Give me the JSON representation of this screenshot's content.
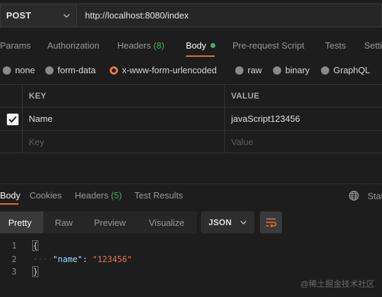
{
  "request": {
    "method": "POST",
    "url": "http://localhost:8080/index"
  },
  "request_tabs": {
    "params": "Params",
    "authorization": "Authorization",
    "headers": "Headers",
    "headers_count": "(8)",
    "body": "Body",
    "pre_request": "Pre-request Script",
    "tests": "Tests",
    "settings": "Setti"
  },
  "body_types": {
    "none": "none",
    "form_data": "form-data",
    "urlencoded": "x-www-form-urlencoded",
    "raw": "raw",
    "binary": "binary",
    "graphql": "GraphQL",
    "selected": "x-www-form-urlencoded"
  },
  "params_table": {
    "key_header": "KEY",
    "value_header": "VALUE",
    "row": {
      "key": "Name",
      "value": "javaScript123456",
      "checked": true
    },
    "placeholder_key": "Key",
    "placeholder_value": "Value"
  },
  "response_tabs": {
    "body": "Body",
    "cookies": "Cookies",
    "headers": "Headers",
    "headers_count": "(5)",
    "test_results": "Test Results",
    "status": "Stat"
  },
  "view_modes": {
    "pretty": "Pretty",
    "raw": "Raw",
    "preview": "Preview",
    "visualize": "Visualize",
    "active": "Pretty"
  },
  "format": "JSON",
  "code": {
    "line_numbers": [
      "1",
      "2",
      "3"
    ],
    "open_brace": "{",
    "indent": "····",
    "key": "\"name\"",
    "colon": ": ",
    "value": "\"123456\"",
    "close_brace": "}"
  },
  "watermark": "@稀土掘金技术社区",
  "colors": {
    "accent": "#f26b3a",
    "success": "#45b26b",
    "json_key": "#9cdcfe",
    "json_string": "#e8774a"
  }
}
